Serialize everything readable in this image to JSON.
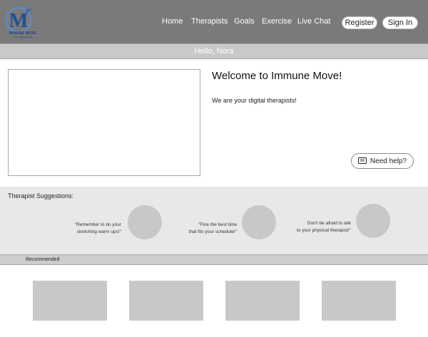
{
  "brand": {
    "logo_text": "IMMUNE MOVE",
    "logo_subtext": "Your digital therapist",
    "logo_color": "#1f3f7a"
  },
  "nav": {
    "items": [
      {
        "label": "Home"
      },
      {
        "label": "Therapists"
      },
      {
        "label": "Goals"
      },
      {
        "label": "Exercise"
      },
      {
        "label": "Live Chat"
      }
    ],
    "register_label": "Register",
    "signin_label": "Sign In"
  },
  "greeting": "Hello, Nora",
  "hero": {
    "title": "Welcome to Immune Move!",
    "subtitle": "We are your digital therapists!",
    "help_label": "Need help?",
    "help_icon": "chat-icon"
  },
  "suggestions": {
    "title": "Therapist Suggestions:",
    "items": [
      {
        "line1": "\"Remember to do your",
        "line2": "stretching warm ups!\""
      },
      {
        "line1": "\"Fine the best time",
        "line2": "that fits your schedule!\""
      },
      {
        "line1": "Don't be afraid to talk",
        "line2": "to your physical therapist!\""
      }
    ]
  },
  "recommended": {
    "label": "Recommended"
  },
  "colors": {
    "header_bg": "#7a7a7a",
    "greeting_bar": "#c9c9c9",
    "suggestion_bg": "#e8e8e8",
    "placeholder": "#c8c8c8"
  }
}
